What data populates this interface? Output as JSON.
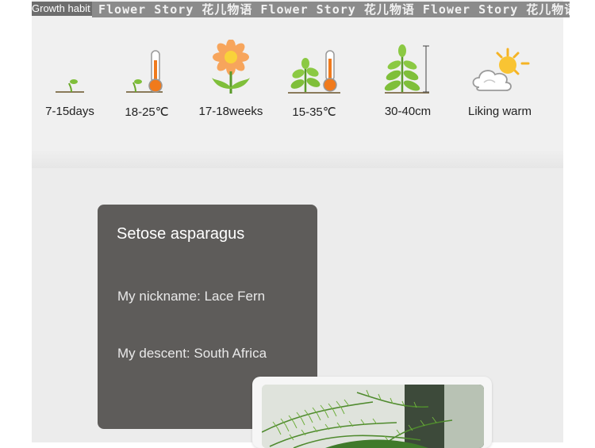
{
  "header": {
    "label": "Growth habit",
    "watermark": "Flower Story 花儿物语 Flower Story 花儿物语 Flower Story 花儿物语"
  },
  "habits": [
    {
      "label": "7-15days",
      "icon": "sprout-icon"
    },
    {
      "label": "18-25℃",
      "icon": "seedling-thermometer-icon"
    },
    {
      "label": "17-18weeks",
      "icon": "flower-icon"
    },
    {
      "label": "15-35℃",
      "icon": "plant-thermometer-icon"
    },
    {
      "label": "30-40cm",
      "icon": "plant-height-icon"
    },
    {
      "label": "Liking warm",
      "icon": "sun-cloud-icon"
    }
  ],
  "card": {
    "title": "Setose asparagus",
    "nickname": "My nickname: Lace Fern",
    "descent": "My descent:  South Africa"
  },
  "colors": {
    "card_bg": "#5e5c5a",
    "panel_bg": "#ececec",
    "leaf_green": "#7fbf3a",
    "thermo_orange": "#f07a1c"
  }
}
